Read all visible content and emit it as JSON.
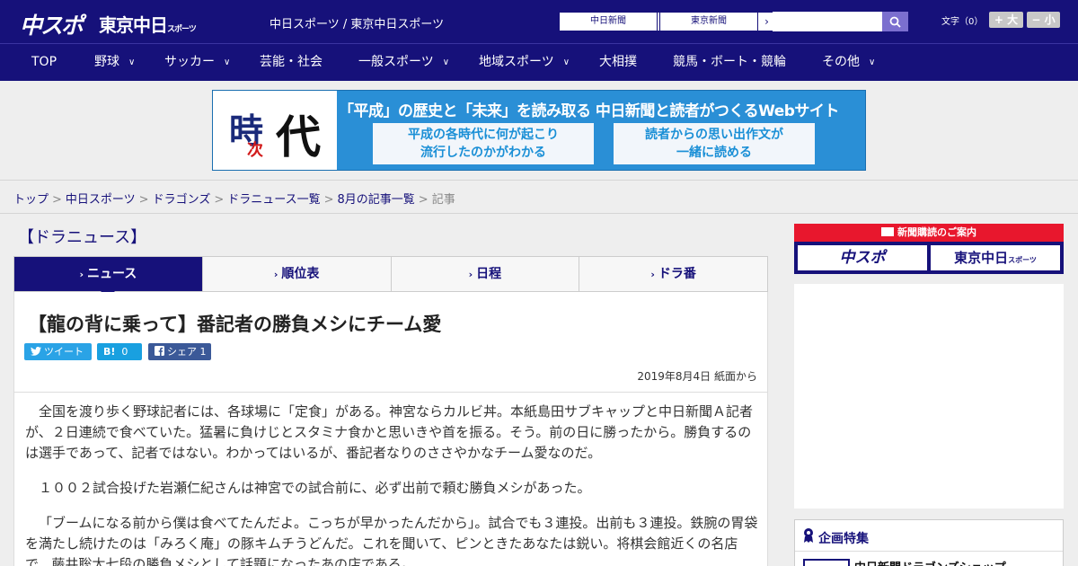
{
  "header": {
    "logo_chuspo": "中スポ",
    "logo_tokyo": "東京中日",
    "logo_tokyo_small": "スポーツ",
    "site_title": "中日スポーツ / 東京中日スポーツ",
    "ext_links": [
      {
        "label": "中日新聞"
      },
      {
        "label": "東京新聞"
      }
    ],
    "search_placeholder": "",
    "font_size_label": "文字（0）",
    "font_larger": "+ 大",
    "font_smaller": "− 小"
  },
  "nav": [
    {
      "label": "TOP",
      "has_menu": false
    },
    {
      "label": "野球",
      "has_menu": true
    },
    {
      "label": "サッカー",
      "has_menu": true
    },
    {
      "label": "芸能・社会",
      "has_menu": false
    },
    {
      "label": "一般スポーツ",
      "has_menu": true
    },
    {
      "label": "地域スポーツ",
      "has_menu": true
    },
    {
      "label": "大相撲",
      "has_menu": false
    },
    {
      "label": "競馬・ボート・競輪",
      "has_menu": false
    },
    {
      "label": "その他",
      "has_menu": true
    }
  ],
  "banner": {
    "kanji_1": "時",
    "kanji_2": "次",
    "kanji_3": "代",
    "headline": "「平成」の歴史と「未来」を読み取る 中日新聞と読者がつくるWebサイト",
    "box_left_1": "平成の各時代に何が起こり",
    "box_left_2": "流行したのかがわかる",
    "box_right_1": "読者からの思い出作文が",
    "box_right_2": "一緒に読める"
  },
  "breadcrumb": {
    "items": [
      "トップ",
      "中日スポーツ",
      "ドラゴンズ",
      "ドラニュース一覧",
      "8月の記事一覧"
    ],
    "current": "記事"
  },
  "section_title": "【ドラニュース】",
  "tabs": [
    {
      "label": "ニュース",
      "active": true
    },
    {
      "label": "順位表",
      "active": false
    },
    {
      "label": "日程",
      "active": false
    },
    {
      "label": "ドラ番",
      "active": false
    }
  ],
  "article": {
    "title": "【龍の背に乗って】番記者の勝負メシにチーム愛",
    "share_tweet": "ツイート",
    "share_hatena_count": "0",
    "share_facebook": "シェア",
    "share_facebook_count": "1",
    "date": "2019年8月4日 紙面から",
    "paragraphs": [
      "全国を渡り歩く野球記者には、各球場に「定食」がある。神宮ならカルビ丼。本紙島田サブキャップと中日新聞Ａ記者が、２日連続で食べていた。猛暑に負けじとスタミナ食かと思いきや首を振る。そう。前の日に勝ったから。勝負するのは選手であって、記者ではない。わかってはいるが、番記者なりのささやかなチーム愛なのだ。",
      "１００２試合投げた岩瀬仁紀さんは神宮での試合前に、必ず出前で頼む勝負メシがあった。",
      "「ブームになる前から僕は食べてたんだよ。こっちが早かったんだから」。試合でも３連投。出前も３連投。鉄腕の胃袋を満たし続けたのは「みろく庵」の豚キムチうどんだ。これを聞いて、ピンときたあなたは鋭い。将棋会館近くの名店で、藤井聡太七段の勝負メシとして話題になったあの店である。"
    ]
  },
  "sidebar": {
    "subscribe_header": "新聞購読のご案内",
    "subscribe_logo_1": "中スポ",
    "subscribe_logo_2": "東京中日",
    "subscribe_logo_2_small": "スポーツ",
    "feature_title": "企画特集",
    "feature_item": "中日新聞ドラゴンズショップ"
  },
  "colors": {
    "brand_navy": "#16117a",
    "accent_red": "#e8172d",
    "twitter": "#2aa3e6",
    "hatena": "#19a0e0",
    "facebook": "#3b5998"
  }
}
